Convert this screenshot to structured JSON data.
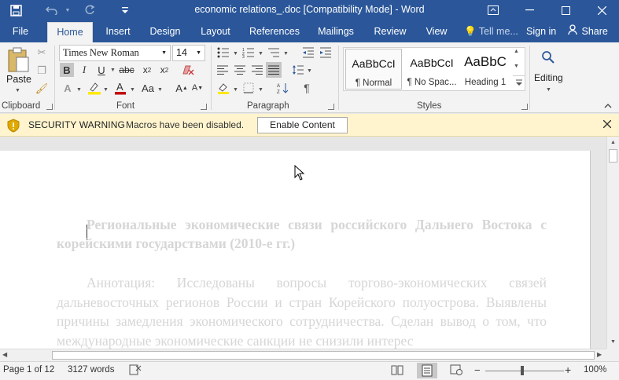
{
  "titlebar": {
    "title": "economic relations_.doc [Compatibility Mode] - Word",
    "save_icon": "save-icon",
    "undo_icon": "undo-icon",
    "redo_icon": "redo-icon",
    "customize_icon": "customize-quick-access-icon"
  },
  "tabs": {
    "file": "File",
    "home": "Home",
    "insert": "Insert",
    "design": "Design",
    "layout": "Layout",
    "references": "References",
    "mailings": "Mailings",
    "review": "Review",
    "view": "View",
    "tellme": "Tell me...",
    "signin": "Sign in",
    "share": "Share"
  },
  "ribbon": {
    "clipboard": {
      "paste": "Paste",
      "label": "Clipboard"
    },
    "font": {
      "name": "Times New Roman",
      "size": "14",
      "bold": "B",
      "italic": "I",
      "underline": "U",
      "label": "Font",
      "change_case": "Aa"
    },
    "paragraph": {
      "label": "Paragraph"
    },
    "styles": {
      "label": "Styles",
      "items": [
        {
          "preview": "AaBbCcI",
          "name": "¶ Normal"
        },
        {
          "preview": "AaBbCcI",
          "name": "¶ No Spac..."
        },
        {
          "preview": "AaBbC",
          "name": "Heading 1"
        }
      ]
    },
    "editing": {
      "label": "Editing"
    }
  },
  "security": {
    "title": "SECURITY WARNING",
    "message": "Macros have been disabled.",
    "button": "Enable Content"
  },
  "document": {
    "title": "Региональные экономические связи российского Дальнего Востока с корейскими государствами (2010-е гг.)",
    "body": "Аннотация: Исследованы вопросы торгово-экономических связей дальневосточных регионов России и стран Корейского полуострова. Выявлены причины замедления экономического сотрудничества. Сделан вывод о том, что международные экономические санкции не снизили интерес"
  },
  "status": {
    "page": "Page 1 of 12",
    "words": "3127 words",
    "zoom": "100%"
  },
  "colors": {
    "brand": "#2b579a",
    "warning_bg": "#fff4ce"
  }
}
